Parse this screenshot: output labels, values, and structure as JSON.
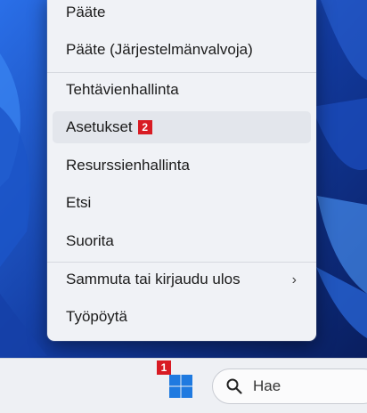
{
  "menu": {
    "items": [
      {
        "label": "Pääte"
      },
      {
        "label": "Pääte (Järjestelmänvalvoja)"
      },
      {
        "label": "Tehtävienhallinta"
      },
      {
        "label": "Asetukset",
        "badge": "2"
      },
      {
        "label": "Resurssienhallinta"
      },
      {
        "label": "Etsi"
      },
      {
        "label": "Suorita"
      },
      {
        "label": "Sammuta tai kirjaudu ulos",
        "chevron": "›"
      },
      {
        "label": "Työpöytä"
      }
    ]
  },
  "taskbar": {
    "start_badge": "1",
    "search_placeholder": "Hae"
  },
  "colors": {
    "badge": "#d81b23",
    "windows_blue": "#1f7ae0",
    "wallpaper": "#0a1e5c"
  },
  "icons": [
    "windows-logo-icon",
    "search-icon",
    "chevron-right-icon"
  ]
}
